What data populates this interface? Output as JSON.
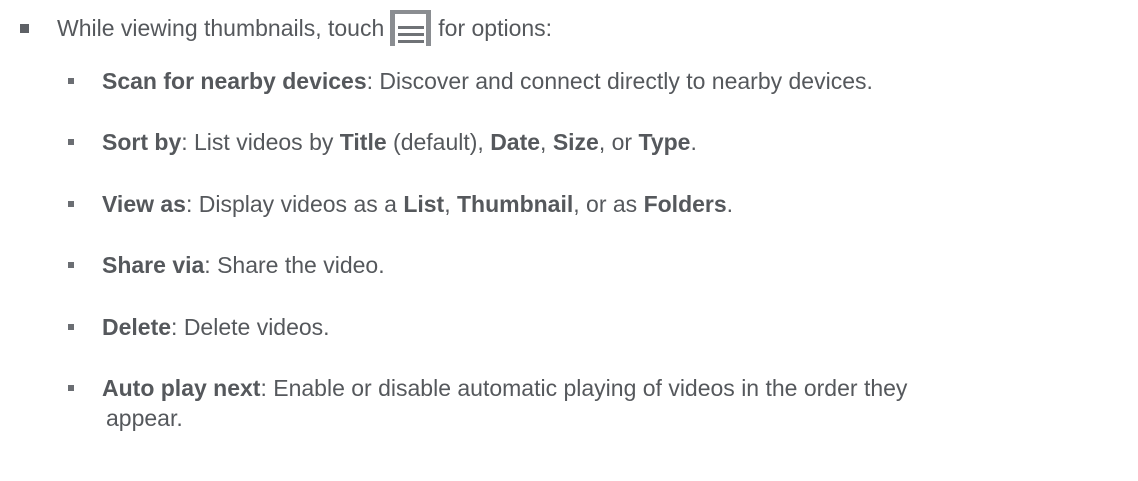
{
  "intro": {
    "before": "While viewing thumbnails, touch",
    "after": "for options:",
    "icon": "menu-icon"
  },
  "options": [
    {
      "label": "Scan for nearby devices",
      "text": ": Discover and connect directly to nearby devices."
    },
    {
      "label": "Sort by",
      "t1": ": List videos by ",
      "b1": "Title",
      "t2": " (default), ",
      "b2": "Date",
      "t3": ", ",
      "b3": "Size",
      "t4": ", or ",
      "b4": "Type",
      "t5": "."
    },
    {
      "label": "View as",
      "t1": ": Display videos as a ",
      "b1": "List",
      "t2": ", ",
      "b2": "Thumbnail",
      "t3": ", or as ",
      "b3": "Folders",
      "t4": "."
    },
    {
      "label": "Share via",
      "text": ": Share the video."
    },
    {
      "label": "Delete",
      "text": ": Delete videos."
    },
    {
      "label": "Auto play next",
      "text": ": Enable or disable automatic playing of videos in the order they",
      "continuation": "appear."
    }
  ]
}
